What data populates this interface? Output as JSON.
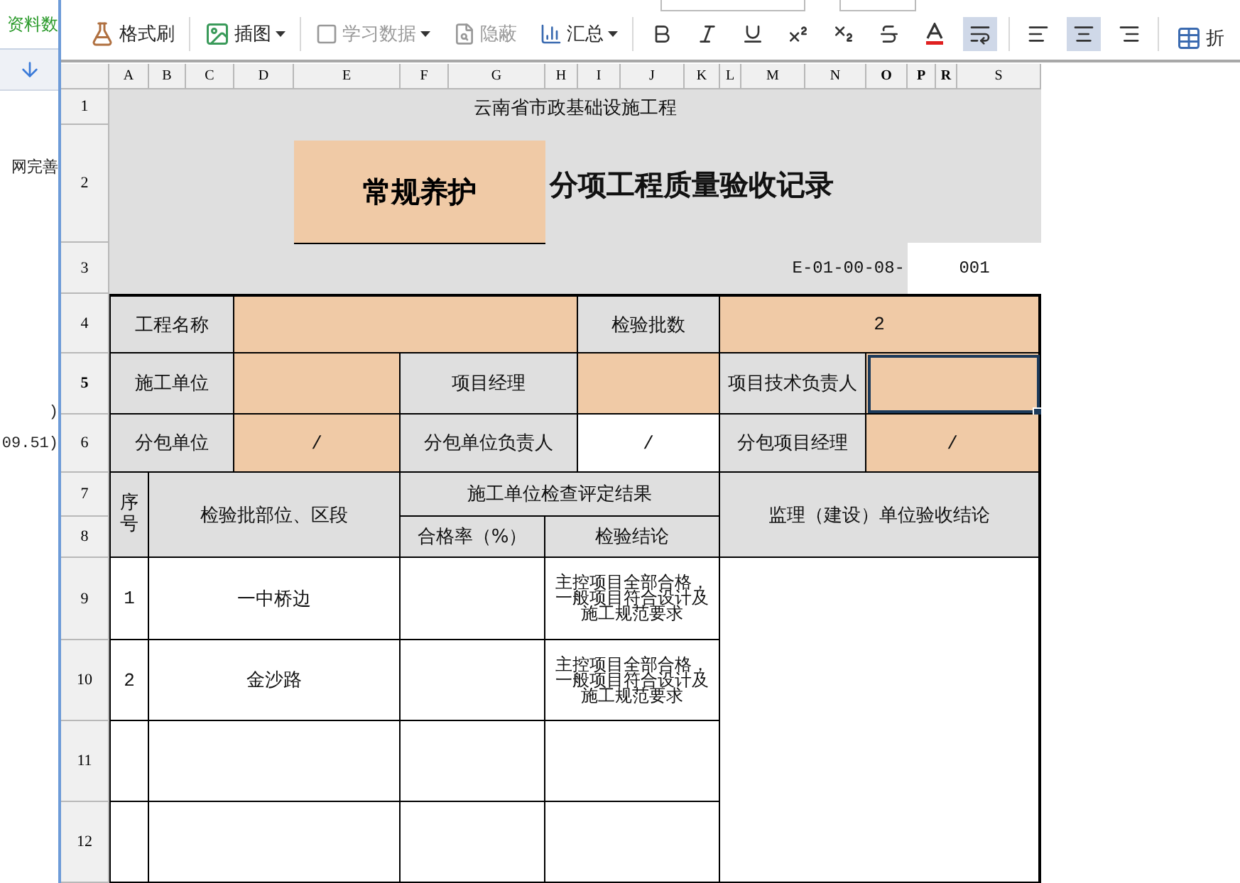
{
  "left_panel": {
    "tab": "资料数",
    "lines": [
      "网完善",
      ")",
      "09.51)"
    ]
  },
  "toolbar": {
    "items": [
      {
        "kind": "painter",
        "label": "格式刷",
        "disabled": false,
        "dropdown": false
      },
      {
        "kind": "picture",
        "label": "插图",
        "disabled": false,
        "dropdown": true
      },
      {
        "kind": "checkbox",
        "label": "学习数据",
        "disabled": true,
        "dropdown": true
      },
      {
        "kind": "hide",
        "label": "隐蔽",
        "disabled": true,
        "dropdown": false
      },
      {
        "kind": "summary",
        "label": "汇总",
        "disabled": false,
        "dropdown": true
      }
    ],
    "format_buttons": [
      {
        "kind": "bold",
        "selected": false
      },
      {
        "kind": "italic",
        "selected": false
      },
      {
        "kind": "underline",
        "selected": false
      },
      {
        "kind": "superscript",
        "selected": false
      },
      {
        "kind": "subscript",
        "selected": false
      },
      {
        "kind": "strike",
        "selected": false
      },
      {
        "kind": "font-color",
        "selected": false
      },
      {
        "kind": "wrap",
        "selected": true
      }
    ],
    "align_buttons": [
      {
        "kind": "left",
        "selected": false
      },
      {
        "kind": "center",
        "selected": true
      },
      {
        "kind": "right",
        "selected": false
      }
    ],
    "table_label": "折"
  },
  "sheet": {
    "columns": [
      {
        "label": "A",
        "selected": false
      },
      {
        "label": "B",
        "selected": false
      },
      {
        "label": "C",
        "selected": false
      },
      {
        "label": "D",
        "selected": false
      },
      {
        "label": "E",
        "selected": false
      },
      {
        "label": "F",
        "selected": false
      },
      {
        "label": "G",
        "selected": false
      },
      {
        "label": "H",
        "selected": false
      },
      {
        "label": "I",
        "selected": false
      },
      {
        "label": "J",
        "selected": false
      },
      {
        "label": "K",
        "selected": false
      },
      {
        "label": "L",
        "selected": false
      },
      {
        "label": "M",
        "selected": false
      },
      {
        "label": "N",
        "selected": false
      },
      {
        "label": "O",
        "selected": true
      },
      {
        "label": "P",
        "selected": true
      },
      {
        "label": "R",
        "selected": true
      },
      {
        "label": "S",
        "selected": false
      }
    ],
    "rows": [
      {
        "label": "1",
        "selected": false
      },
      {
        "label": "2",
        "selected": false
      },
      {
        "label": "3",
        "selected": false
      },
      {
        "label": "4",
        "selected": false
      },
      {
        "label": "5",
        "selected": true
      },
      {
        "label": "6",
        "selected": false
      },
      {
        "label": "7",
        "selected": false
      },
      {
        "label": "8",
        "selected": false
      },
      {
        "label": "9",
        "selected": false
      },
      {
        "label": "10",
        "selected": false
      },
      {
        "label": "11",
        "selected": false
      },
      {
        "label": "12",
        "selected": false
      }
    ],
    "header": "云南省市政基础设施工程",
    "category": "常规养护",
    "title": "分项工程质量验收记录",
    "code": "E-01-00-08-",
    "number": "001",
    "info_rows": [
      {
        "cells": [
          {
            "kind": "label",
            "text": "工程名称",
            "selected": false
          },
          {
            "kind": "input",
            "selected": false
          },
          {
            "kind": "label",
            "text": "检验批数",
            "selected": false
          },
          {
            "kind": "input",
            "text": "2",
            "selected": false
          }
        ]
      },
      {
        "cells": [
          {
            "kind": "label",
            "text": "施工单位",
            "selected": false
          },
          {
            "kind": "input",
            "selected": false
          },
          {
            "kind": "label",
            "text": "项目经理",
            "selected": false
          },
          {
            "kind": "input",
            "selected": false
          },
          {
            "kind": "label",
            "text": "项目技术负责人",
            "selected": false
          },
          {
            "kind": "input",
            "selected": true
          }
        ]
      },
      {
        "cells": [
          {
            "kind": "label",
            "text": "分包单位",
            "selected": false
          },
          {
            "kind": "input",
            "text": "/",
            "selected": false
          },
          {
            "kind": "label",
            "text": "分包单位负责人",
            "selected": false
          },
          {
            "kind": "blank",
            "text": "/",
            "selected": false
          },
          {
            "kind": "label",
            "text": "分包项目经理",
            "selected": false
          },
          {
            "kind": "input",
            "text": "/",
            "selected": false
          }
        ]
      }
    ],
    "table_header": {
      "index": "序号",
      "location": "检验批部位、区段",
      "group": "施工单位检查评定结果",
      "rate": "合格率（%）",
      "conclusion": "检验结论",
      "supervision": "监理（建设）单位验收结论"
    },
    "table_rows": [
      {
        "index": "1",
        "location": "一中桥边",
        "conclusion": "主控项目全部合格，一般项目符合设计及施工规范要求"
      },
      {
        "index": "2",
        "location": "金沙路",
        "conclusion": "主控项目全部合格，一般项目符合设计及施工规范要求"
      }
    ]
  }
}
